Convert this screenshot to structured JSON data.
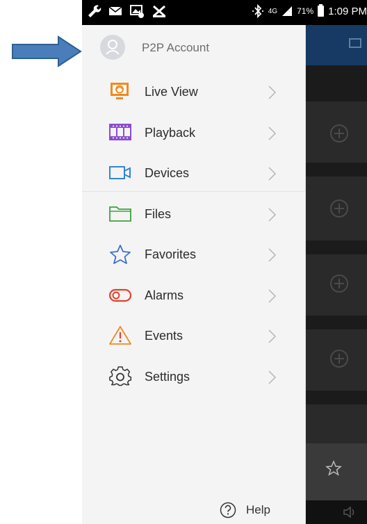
{
  "status_bar": {
    "network_label": "4G",
    "battery_percent": "71%",
    "time": "1:09 PM",
    "left_icons": [
      "wrench-icon",
      "mail-icon",
      "gallery-icon",
      "x-notification-icon"
    ],
    "right_icons": [
      "bluetooth-icon",
      "signal-icon",
      "battery-icon"
    ]
  },
  "drawer": {
    "account": {
      "label": "P2P Account",
      "icon": "user-avatar-icon"
    },
    "items": [
      {
        "label": "Live View",
        "icon": "monitor-icon",
        "color": "#f08a1c"
      },
      {
        "label": "Playback",
        "icon": "film-icon",
        "color": "#8a4dcf"
      },
      {
        "label": "Devices",
        "icon": "camera-icon",
        "color": "#2f86d4"
      },
      {
        "label": "Files",
        "icon": "folder-icon",
        "color": "#3ba33b"
      },
      {
        "label": "Favorites",
        "icon": "star-icon",
        "color": "#3c6fd1"
      },
      {
        "label": "Alarms",
        "icon": "alarm-icon",
        "color": "#e4402c"
      },
      {
        "label": "Events",
        "icon": "warning-icon",
        "color": "#f08a1c"
      },
      {
        "label": "Settings",
        "icon": "gear-icon",
        "color": "#333333"
      }
    ],
    "help": {
      "label": "Help",
      "icon": "question-icon"
    }
  },
  "colors": {
    "drawer_bg": "#f4f4f4",
    "header_blue": "#163a63",
    "arrow_fill": "#4a7ebb"
  }
}
